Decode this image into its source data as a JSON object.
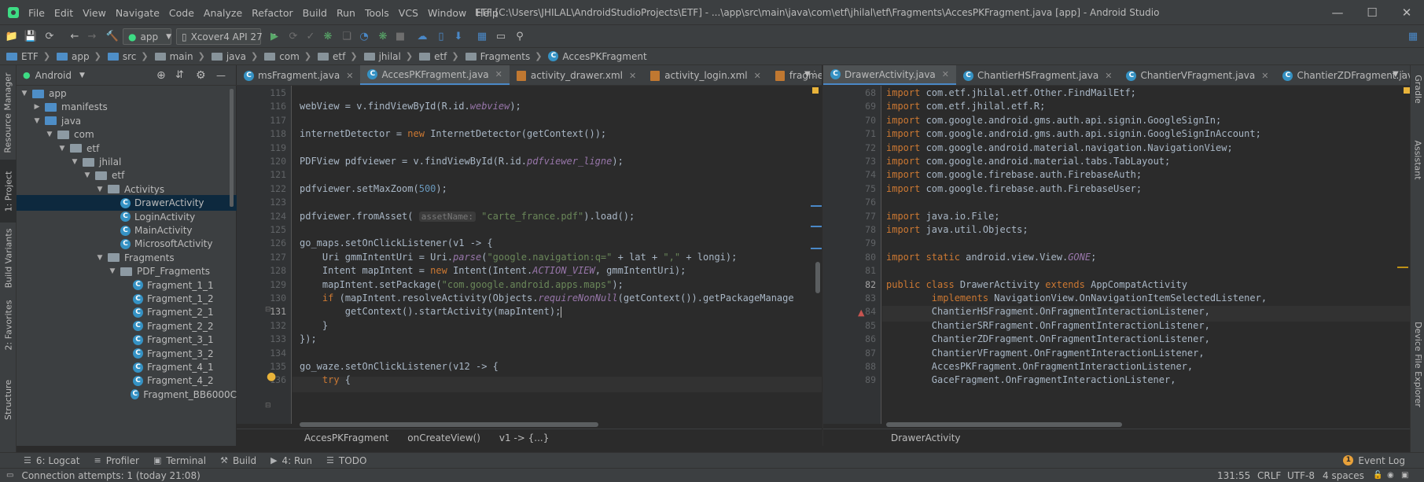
{
  "menu": [
    "File",
    "Edit",
    "View",
    "Navigate",
    "Code",
    "Analyze",
    "Refactor",
    "Build",
    "Run",
    "Tools",
    "VCS",
    "Window",
    "Help"
  ],
  "window_title": "ETF [C:\\Users\\JHILAL\\AndroidStudioProjects\\ETF] - ...\\app\\src\\main\\java\\com\\etf\\jhilal\\etf\\Fragments\\AccesPKFragment.java [app] - Android Studio",
  "toolbar": {
    "config": "app",
    "device": "Xcover4 API 27"
  },
  "breadcrumbs": [
    "ETF",
    "app",
    "src",
    "main",
    "java",
    "com",
    "etf",
    "jhilal",
    "etf",
    "Fragments",
    "AccesPKFragment"
  ],
  "project_panel": {
    "view": "Android"
  },
  "left_tabs": [
    "Resource Manager",
    "1: Project",
    "Build Variants",
    "2: Favorites",
    "Structure"
  ],
  "right_tabs": [
    "Gradle",
    "Assistant",
    "Device File Explorer"
  ],
  "tree": [
    {
      "label": "app",
      "depth": 0,
      "kind": "folder-blue",
      "open": true
    },
    {
      "label": "manifests",
      "depth": 1,
      "kind": "folder-blue",
      "open": false
    },
    {
      "label": "java",
      "depth": 1,
      "kind": "folder-blue",
      "open": true
    },
    {
      "label": "com",
      "depth": 2,
      "kind": "pkg",
      "open": true
    },
    {
      "label": "etf",
      "depth": 3,
      "kind": "pkg",
      "open": true
    },
    {
      "label": "jhilal",
      "depth": 4,
      "kind": "pkg",
      "open": true
    },
    {
      "label": "etf",
      "depth": 5,
      "kind": "pkg",
      "open": true
    },
    {
      "label": "Activitys",
      "depth": 6,
      "kind": "pkg",
      "open": true
    },
    {
      "label": "DrawerActivity",
      "depth": 7,
      "kind": "class",
      "selected": true
    },
    {
      "label": "LoginActivity",
      "depth": 7,
      "kind": "class"
    },
    {
      "label": "MainActivity",
      "depth": 7,
      "kind": "class"
    },
    {
      "label": "MicrosoftActivity",
      "depth": 7,
      "kind": "class"
    },
    {
      "label": "Fragments",
      "depth": 6,
      "kind": "pkg",
      "open": true
    },
    {
      "label": "PDF_Fragments",
      "depth": 7,
      "kind": "pkg",
      "open": true
    },
    {
      "label": "Fragment_1_1",
      "depth": 8,
      "kind": "class"
    },
    {
      "label": "Fragment_1_2",
      "depth": 8,
      "kind": "class"
    },
    {
      "label": "Fragment_2_1",
      "depth": 8,
      "kind": "class"
    },
    {
      "label": "Fragment_2_2",
      "depth": 8,
      "kind": "class"
    },
    {
      "label": "Fragment_3_1",
      "depth": 8,
      "kind": "class"
    },
    {
      "label": "Fragment_3_2",
      "depth": 8,
      "kind": "class"
    },
    {
      "label": "Fragment_4_1",
      "depth": 8,
      "kind": "class"
    },
    {
      "label": "Fragment_4_2",
      "depth": 8,
      "kind": "class"
    },
    {
      "label": "Fragment_BB6000C",
      "depth": 8,
      "kind": "class"
    }
  ],
  "editor_left": {
    "tabs": [
      {
        "label": "msFragment.java",
        "icon": "class"
      },
      {
        "label": "AccesPKFragment.java",
        "icon": "class",
        "active": true
      },
      {
        "label": "activity_drawer.xml",
        "icon": "xml"
      },
      {
        "label": "activity_login.xml",
        "icon": "xml"
      },
      {
        "label": "fragment_forms.xr",
        "icon": "xml"
      }
    ],
    "first_line": 115,
    "current_line": 131,
    "lines": [
      [],
      [
        [
          "",
          "webView = v.findViewById(R.id."
        ],
        [
          "fi",
          "webview"
        ],
        [
          "",
          "); "
        ]
      ],
      [],
      [
        [
          "",
          "internetDetector = "
        ],
        [
          "kw",
          "new "
        ],
        [
          "",
          "InternetDetector(getContext());"
        ]
      ],
      [],
      [
        [
          "",
          "PDFView pdfviewer = v.findViewById(R.id."
        ],
        [
          "fi",
          "pdfviewer_ligne"
        ],
        [
          "",
          ");"
        ]
      ],
      [],
      [
        [
          "",
          "pdfviewer.setMaxZoom("
        ],
        [
          "cn",
          "500"
        ],
        [
          "",
          ");"
        ]
      ],
      [],
      [
        [
          "",
          "pdfviewer.fromAsset( "
        ],
        [
          "hint",
          "assetName:"
        ],
        [
          "st",
          " \"carte_france.pdf\""
        ],
        [
          "",
          ").load();"
        ]
      ],
      [],
      [
        [
          "",
          "go_maps.setOnClickListener(v1 -> {"
        ]
      ],
      [
        [
          "",
          "    Uri gmmIntentUri = Uri."
        ],
        [
          "it",
          "parse"
        ],
        [
          "",
          "("
        ],
        [
          "st",
          "\"google.navigation:q=\""
        ],
        [
          "",
          " + lat + "
        ],
        [
          "st",
          "\",\""
        ],
        [
          "",
          " + longi);"
        ]
      ],
      [
        [
          "",
          "    Intent mapIntent = "
        ],
        [
          "kw",
          "new "
        ],
        [
          "",
          "Intent(Intent."
        ],
        [
          "fi",
          "ACTION_VIEW"
        ],
        [
          "",
          ", gmmIntentUri);"
        ]
      ],
      [
        [
          "",
          "    mapIntent.setPackage("
        ],
        [
          "st",
          "\"com.google.android.apps.maps\""
        ],
        [
          "",
          ");"
        ]
      ],
      [
        [
          "",
          "    "
        ],
        [
          "kw",
          "if "
        ],
        [
          "",
          "(mapIntent.resolveActivity(Objects."
        ],
        [
          "it",
          "requireNonNull"
        ],
        [
          "",
          "(getContext()).getPackageManage"
        ]
      ],
      [
        [
          "",
          "        getContext().startActivity(mapIntent);"
        ]
      ],
      [
        [
          "",
          "    }"
        ]
      ],
      [
        [
          "",
          "});"
        ]
      ],
      [],
      [
        [
          "",
          "go_waze.setOnClickListener(v12 -> {"
        ]
      ],
      [
        [
          "kw",
          "    try "
        ],
        [
          "",
          "{"
        ]
      ]
    ],
    "crumbs": [
      "AccesPKFragment",
      "onCreateView()",
      "v1 -> {...}"
    ]
  },
  "editor_right": {
    "tabs": [
      {
        "label": "DrawerActivity.java",
        "icon": "class",
        "active": true
      },
      {
        "label": "ChantierHSFragment.java",
        "icon": "class"
      },
      {
        "label": "ChantierVFragment.java",
        "icon": "class"
      },
      {
        "label": "ChantierZDFragment.java",
        "icon": "class"
      }
    ],
    "first_line": 68,
    "current_line": 82,
    "lines": [
      [
        [
          "kw",
          "import "
        ],
        [
          "",
          "com.etf.jhilal.etf.Other.FindMailEtf;"
        ]
      ],
      [
        [
          "kw",
          "import "
        ],
        [
          "",
          "com.etf.jhilal.etf.R;"
        ]
      ],
      [
        [
          "kw",
          "import "
        ],
        [
          "",
          "com.google.android.gms.auth.api.signin.GoogleSignIn;"
        ]
      ],
      [
        [
          "kw",
          "import "
        ],
        [
          "",
          "com.google.android.gms.auth.api.signin.GoogleSignInAccount;"
        ]
      ],
      [
        [
          "kw",
          "import "
        ],
        [
          "",
          "com.google.android.material.navigation.NavigationView;"
        ]
      ],
      [
        [
          "kw",
          "import "
        ],
        [
          "",
          "com.google.android.material.tabs.TabLayout;"
        ]
      ],
      [
        [
          "kw",
          "import "
        ],
        [
          "",
          "com.google.firebase.auth.FirebaseAuth;"
        ]
      ],
      [
        [
          "kw",
          "import "
        ],
        [
          "",
          "com.google.firebase.auth.FirebaseUser;"
        ]
      ],
      [],
      [
        [
          "kw",
          "import "
        ],
        [
          "",
          "java.io.File;"
        ]
      ],
      [
        [
          "kw",
          "import "
        ],
        [
          "",
          "java.util.Objects;"
        ]
      ],
      [],
      [
        [
          "kw",
          "import static "
        ],
        [
          "",
          "android.view.View."
        ],
        [
          "fi",
          "GONE"
        ],
        [
          "",
          ";"
        ]
      ],
      [],
      [
        [
          "kw",
          "public class "
        ],
        [
          "",
          "DrawerActivity "
        ],
        [
          "kw",
          "extends "
        ],
        [
          "",
          "AppCompatActivity"
        ]
      ],
      [
        [
          "kw",
          "        implements "
        ],
        [
          "",
          "NavigationView.OnNavigationItemSelectedListener,"
        ]
      ],
      [
        [
          "",
          "        ChantierHSFragment.OnFragmentInteractionListener,"
        ]
      ],
      [
        [
          "",
          "        ChantierSRFragment.OnFragmentInteractionListener,"
        ]
      ],
      [
        [
          "",
          "        ChantierZDFragment.OnFragmentInteractionListener,"
        ]
      ],
      [
        [
          "",
          "        ChantierVFragment.OnFragmentInteractionListener,"
        ]
      ],
      [
        [
          "",
          "        AccesPKFragment.OnFragmentInteractionListener,"
        ]
      ],
      [
        [
          "",
          "        GaceFragment.OnFragmentInteractionListener,"
        ]
      ]
    ],
    "crumbs": [
      "DrawerActivity"
    ]
  },
  "tool_windows": [
    {
      "label": "6: Logcat",
      "icon": "logcat-icon"
    },
    {
      "label": "Profiler",
      "icon": "profiler-icon"
    },
    {
      "label": "Terminal",
      "icon": "terminal-icon"
    },
    {
      "label": "Build",
      "icon": "build-icon"
    },
    {
      "label": "4: Run",
      "icon": "run-icon"
    },
    {
      "label": "TODO",
      "icon": "todo-icon"
    }
  ],
  "event_log": "Event Log",
  "status": {
    "message": "Connection attempts: 1 (today 21:08)",
    "position": "131:55",
    "line_sep": "CRLF",
    "encoding": "UTF-8",
    "indent": "4 spaces"
  },
  "colors": {
    "accent": "#4a88c7",
    "selection": "#0d293e",
    "keyword": "#cc7832",
    "string": "#6a8759",
    "field": "#9876aa"
  }
}
